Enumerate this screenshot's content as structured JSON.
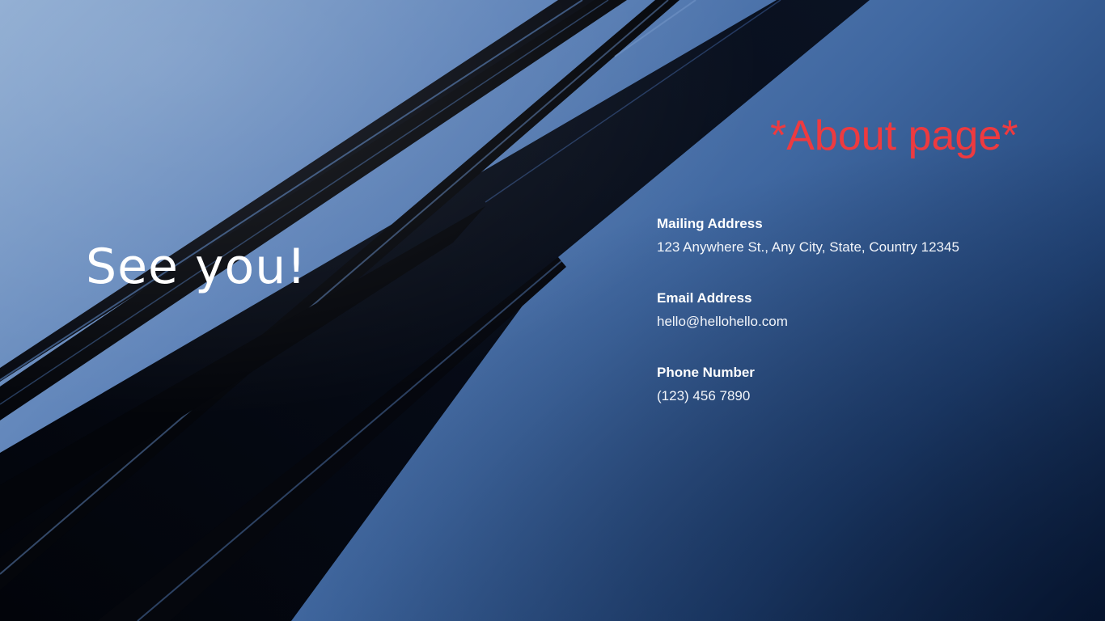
{
  "slide": {
    "headline": "See you!",
    "page_tag": "*About page*",
    "contacts": [
      {
        "label": "Mailing Address",
        "value": "123 Anywhere St., Any City, State, Country 12345"
      },
      {
        "label": "Email Address",
        "value": "hello@hellohello.com"
      },
      {
        "label": "Phone Number",
        "value": "(123) 456 7890"
      }
    ]
  },
  "colors": {
    "accent_red": "#ee3a3f",
    "text_white": "#ffffff",
    "sky_light": "#8aa9d0",
    "sky_dark": "#0c1f3f",
    "cable_black": "#05070c"
  },
  "background": {
    "image": "cable-bridge-photo"
  }
}
